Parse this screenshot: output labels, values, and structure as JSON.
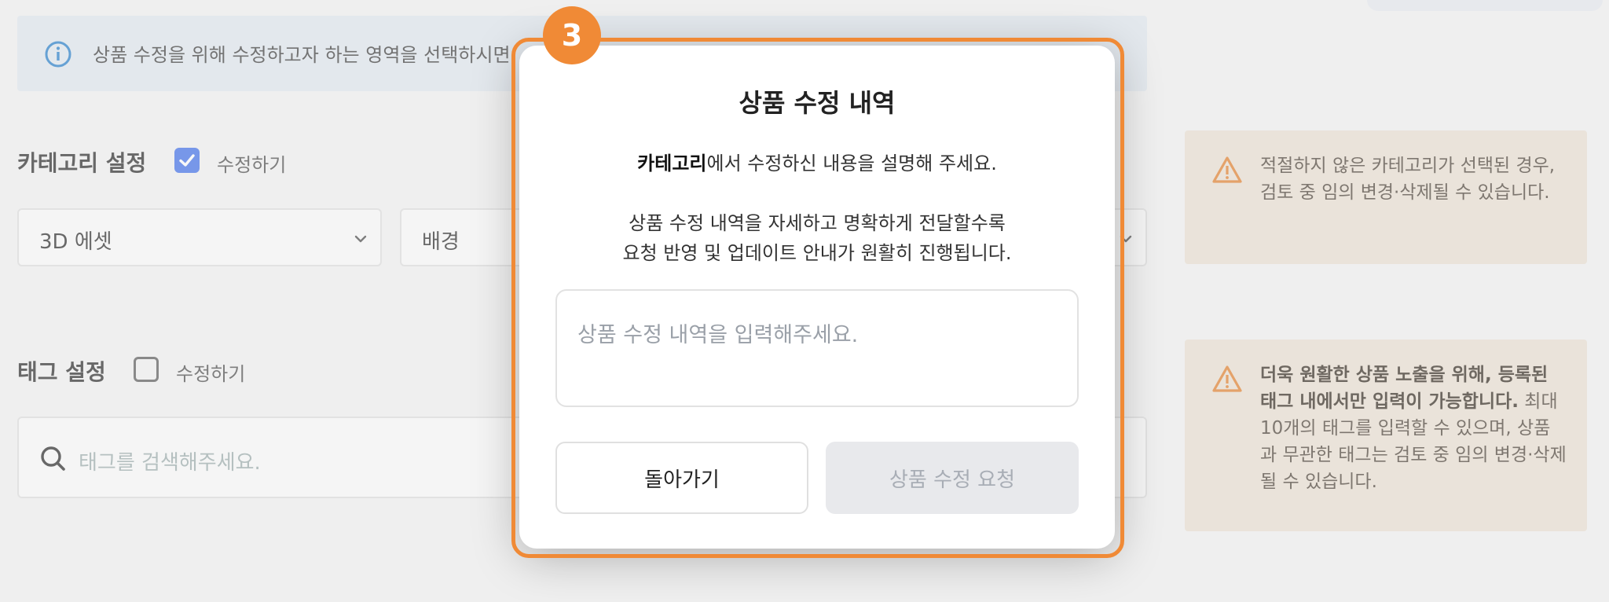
{
  "info_banner": {
    "text": "상품 수정을 위해 수정하고자 하는 영역을 선택하시면"
  },
  "category": {
    "label": "카테고리 설정",
    "edit_checkbox": {
      "label": "수정하기",
      "checked": true
    },
    "select1": {
      "value": "3D 에셋"
    },
    "select2": {
      "value": "배경"
    }
  },
  "tag": {
    "label": "태그 설정",
    "edit_checkbox": {
      "label": "수정하기",
      "checked": false
    },
    "search_placeholder": "태그를 검색해주세요."
  },
  "warnings": [
    {
      "text": "적절하지 않은 카테고리가 선택된 경우, 검토 중 임의 변경·삭제될 수 있습니다."
    },
    {
      "bold": "더욱 원활한 상품 노출을 위해, 등록된 태그 내에서만 입력이 가능합니다.",
      "text": " 최대 10개의 태그를 입력할 수 있으며, 상품과 무관한 태그는 검토 중 임의 변경·삭제될 수 있습니다."
    }
  ],
  "step_badge": "3",
  "modal": {
    "title": "상품 수정 내역",
    "desc_bold": "카테고리",
    "desc_rest": "에서 수정하신 내용을 설명해 주세요.",
    "desc_line2": "상품 수정 내역을 자세하고 명확하게 전달할수록",
    "desc_line3": "요청 반영 및 업데이트 안내가 원활히 진행됩니다.",
    "textarea_placeholder": "상품 수정 내역을 입력해주세요.",
    "back_button": "돌아가기",
    "submit_button": "상품 수정 요청"
  },
  "colors": {
    "accent_orange": "#f08a36",
    "checkbox_blue": "#3a6ae8",
    "info_blue": "#1f7ac8",
    "warn_orange": "#e07b25"
  }
}
